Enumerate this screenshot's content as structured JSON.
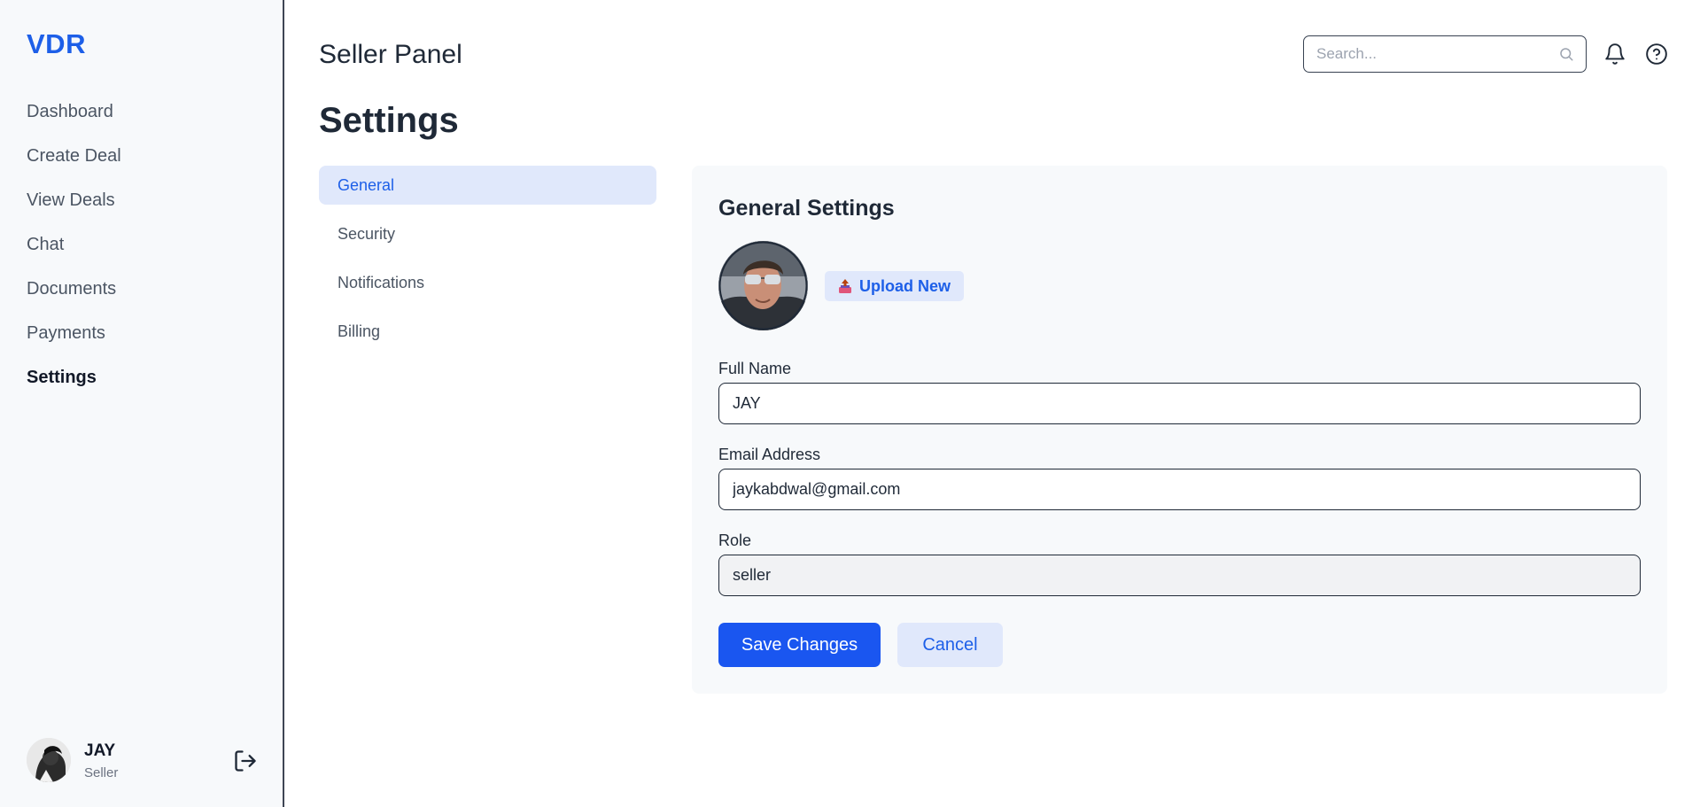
{
  "brand": {
    "logo": "VDR",
    "accent": "#1d5fe8"
  },
  "sidebar": {
    "items": [
      {
        "label": "Dashboard"
      },
      {
        "label": "Create Deal"
      },
      {
        "label": "View Deals"
      },
      {
        "label": "Chat"
      },
      {
        "label": "Documents"
      },
      {
        "label": "Payments"
      },
      {
        "label": "Settings",
        "active": true
      }
    ],
    "user": {
      "name": "JAY",
      "role": "Seller",
      "logout_icon": "logout-icon"
    }
  },
  "header": {
    "panel_title": "Seller Panel",
    "search_placeholder": "Search...",
    "icons": [
      "search-icon",
      "bell-icon",
      "help-icon"
    ]
  },
  "page": {
    "title": "Settings"
  },
  "settings_tabs": [
    {
      "label": "General",
      "active": true
    },
    {
      "label": "Security"
    },
    {
      "label": "Notifications"
    },
    {
      "label": "Billing"
    }
  ],
  "general": {
    "heading": "General Settings",
    "upload_label": "Upload New",
    "full_name_label": "Full Name",
    "full_name_value": "JAY",
    "email_label": "Email Address",
    "email_value": "jaykabdwal@gmail.com",
    "role_label": "Role",
    "role_value": "seller",
    "save_label": "Save Changes",
    "cancel_label": "Cancel"
  }
}
